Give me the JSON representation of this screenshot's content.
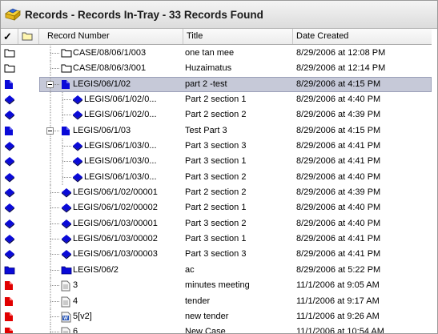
{
  "window": {
    "title": "Records - Records In-Tray - 33 Records Found",
    "icon": "in-tray-icon"
  },
  "columns": {
    "check_mark": "✓",
    "record_number": "Record Number",
    "title": "Title",
    "date_created": "Date Created"
  },
  "colors": {
    "selection": "#c6c9d8",
    "blue_icon": "#0a0ad8",
    "red_icon": "#e10000"
  },
  "rows": [
    {
      "record_number": "CASE/08/06/1/003",
      "title": "one tan mee",
      "date_created": "8/29/2006 at 12:08 PM",
      "status_icon": "folder-outline-icon",
      "type_icon": "folder-outline-icon",
      "level": 1,
      "expander": "none",
      "selected": false
    },
    {
      "record_number": "CASE/08/06/3/001",
      "title": "Huzaimatus",
      "date_created": "8/29/2006 at 12:14 PM",
      "status_icon": "folder-outline-icon",
      "type_icon": "folder-outline-icon",
      "level": 1,
      "expander": "none",
      "selected": false
    },
    {
      "record_number": "LEGIS/06/1/02",
      "title": "part 2 -test",
      "date_created": "8/29/2006 at 4:15 PM",
      "status_icon": "blue-document-icon",
      "type_icon": "blue-document-icon",
      "level": 1,
      "expander": "minus",
      "selected": true
    },
    {
      "record_number": "LEGIS/06/1/02/0...",
      "title": "Part 2 section 1",
      "date_created": "8/29/2006 at 4:40 PM",
      "status_icon": "blue-book-icon",
      "type_icon": "blue-book-icon",
      "level": 2,
      "expander": "none",
      "selected": false
    },
    {
      "record_number": "LEGIS/06/1/02/0...",
      "title": "Part 2 section 2",
      "date_created": "8/29/2006 at 4:39 PM",
      "status_icon": "blue-book-icon",
      "type_icon": "blue-book-icon",
      "level": 2,
      "expander": "none",
      "selected": false
    },
    {
      "record_number": "LEGIS/06/1/03",
      "title": "Test Part 3",
      "date_created": "8/29/2006 at 4:15 PM",
      "status_icon": "blue-document-icon",
      "type_icon": "blue-document-icon",
      "level": 1,
      "expander": "minus",
      "selected": false
    },
    {
      "record_number": "LEGIS/06/1/03/0...",
      "title": "Part 3 section 3",
      "date_created": "8/29/2006 at 4:41 PM",
      "status_icon": "blue-book-icon",
      "type_icon": "blue-book-icon",
      "level": 2,
      "expander": "none",
      "selected": false
    },
    {
      "record_number": "LEGIS/06/1/03/0...",
      "title": "Part 3 section 1",
      "date_created": "8/29/2006 at 4:41 PM",
      "status_icon": "blue-book-icon",
      "type_icon": "blue-book-icon",
      "level": 2,
      "expander": "none",
      "selected": false
    },
    {
      "record_number": "LEGIS/06/1/03/0...",
      "title": "Part 3 section 2",
      "date_created": "8/29/2006 at 4:40 PM",
      "status_icon": "blue-book-icon",
      "type_icon": "blue-book-icon",
      "level": 2,
      "expander": "none",
      "selected": false
    },
    {
      "record_number": "LEGIS/06/1/02/00001",
      "title": "Part 2 section 2",
      "date_created": "8/29/2006 at 4:39 PM",
      "status_icon": "blue-book-icon",
      "type_icon": "blue-book-icon",
      "level": 1,
      "expander": "none",
      "selected": false
    },
    {
      "record_number": "LEGIS/06/1/02/00002",
      "title": "Part 2 section 1",
      "date_created": "8/29/2006 at 4:40 PM",
      "status_icon": "blue-book-icon",
      "type_icon": "blue-book-icon",
      "level": 1,
      "expander": "none",
      "selected": false
    },
    {
      "record_number": "LEGIS/06/1/03/00001",
      "title": "Part 3 section 2",
      "date_created": "8/29/2006 at 4:40 PM",
      "status_icon": "blue-book-icon",
      "type_icon": "blue-book-icon",
      "level": 1,
      "expander": "none",
      "selected": false
    },
    {
      "record_number": "LEGIS/06/1/03/00002",
      "title": "Part 3 section 1",
      "date_created": "8/29/2006 at 4:41 PM",
      "status_icon": "blue-book-icon",
      "type_icon": "blue-book-icon",
      "level": 1,
      "expander": "none",
      "selected": false
    },
    {
      "record_number": "LEGIS/06/1/03/00003",
      "title": "Part 3 section 3",
      "date_created": "8/29/2006 at 4:41 PM",
      "status_icon": "blue-book-icon",
      "type_icon": "blue-book-icon",
      "level": 1,
      "expander": "none",
      "selected": false
    },
    {
      "record_number": "LEGIS/06/2",
      "title": "ac",
      "date_created": "8/29/2006 at 5:22 PM",
      "status_icon": "blue-folder-icon",
      "type_icon": "blue-folder-icon",
      "level": 1,
      "expander": "none",
      "selected": false
    },
    {
      "record_number": "3",
      "title": "minutes meeting",
      "date_created": "11/1/2006 at 9:05 AM",
      "status_icon": "red-document-icon",
      "type_icon": "text-file-icon",
      "level": 1,
      "expander": "none",
      "selected": false
    },
    {
      "record_number": "4",
      "title": "tender",
      "date_created": "11/1/2006 at 9:17 AM",
      "status_icon": "red-document-icon",
      "type_icon": "text-file-icon",
      "level": 1,
      "expander": "none",
      "selected": false
    },
    {
      "record_number": "5[v2]",
      "title": "new tender",
      "date_created": "11/1/2006 at 9:26 AM",
      "status_icon": "red-document-icon",
      "type_icon": "word-file-icon",
      "level": 1,
      "expander": "none",
      "selected": false
    },
    {
      "record_number": "6",
      "title": "New Case",
      "date_created": "11/1/2006 at 10:54 AM",
      "status_icon": "red-document-icon",
      "type_icon": "text-file-icon",
      "level": 1,
      "expander": "none",
      "selected": false
    }
  ]
}
